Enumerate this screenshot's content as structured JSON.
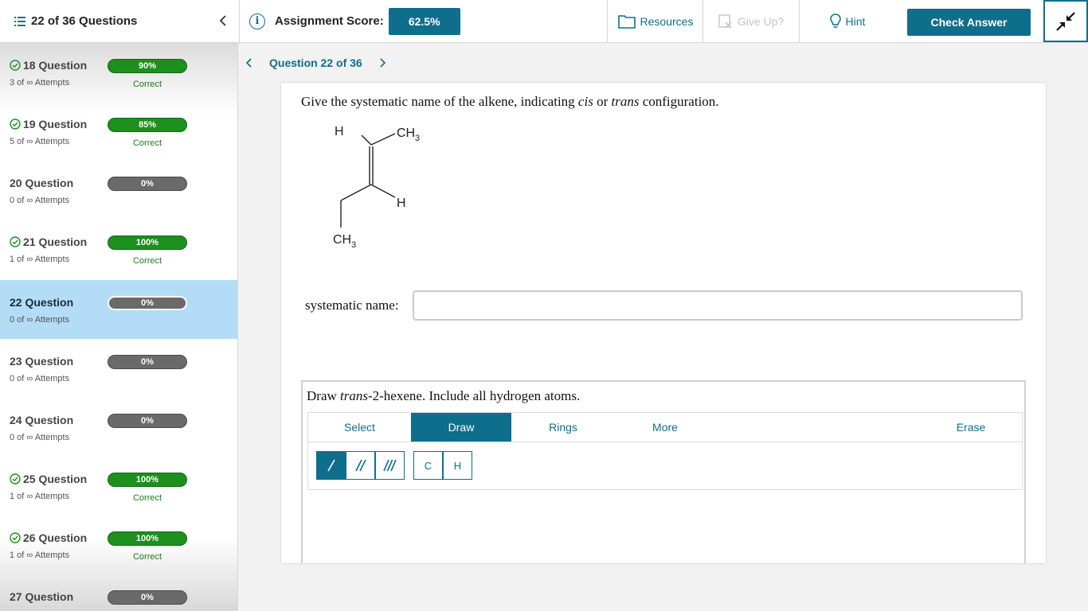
{
  "header": {
    "question_count": "22 of 36 Questions",
    "score_label": "Assignment Score:",
    "score_value": "62.5%",
    "resources": "Resources",
    "give_up": "Give Up?",
    "hint": "Hint",
    "check_answer": "Check Answer"
  },
  "sidebar": {
    "items": [
      {
        "title": "18 Question",
        "attempts": "3 of ∞ Attempts",
        "percent": "90%",
        "status": "Correct"
      },
      {
        "title": "19 Question",
        "attempts": "5 of ∞ Attempts",
        "percent": "85%",
        "status": "Correct"
      },
      {
        "title": "20 Question",
        "attempts": "0 of ∞ Attempts",
        "percent": "0%",
        "status": ""
      },
      {
        "title": "21 Question",
        "attempts": "1 of ∞ Attempts",
        "percent": "100%",
        "status": "Correct"
      },
      {
        "title": "22 Question",
        "attempts": "0 of ∞ Attempts",
        "percent": "0%",
        "status": ""
      },
      {
        "title": "23 Question",
        "attempts": "0 of ∞ Attempts",
        "percent": "0%",
        "status": ""
      },
      {
        "title": "24 Question",
        "attempts": "0 of ∞ Attempts",
        "percent": "0%",
        "status": ""
      },
      {
        "title": "25 Question",
        "attempts": "1 of ∞ Attempts",
        "percent": "100%",
        "status": "Correct"
      },
      {
        "title": "26 Question",
        "attempts": "1 of ∞ Attempts",
        "percent": "100%",
        "status": "Correct"
      },
      {
        "title": "27 Question",
        "attempts": "",
        "percent": "0%",
        "status": ""
      }
    ]
  },
  "main": {
    "nav_label": "Question 22 of 36",
    "prompt_pre": "Give the systematic name of the alkene, indicating ",
    "prompt_cis": "cis",
    "prompt_or": " or ",
    "prompt_trans": "trans",
    "prompt_post": " configuration.",
    "molecule": {
      "h_top": "H",
      "ch3_top": "CH",
      "sub3": "3",
      "h_right": "H",
      "ch3_bottom": "CH"
    },
    "name_label": "systematic name:",
    "name_value": "",
    "draw_pre": "Draw ",
    "draw_italic": "trans",
    "draw_post": "-2-hexene. Include all hydrogen atoms.",
    "tabs": {
      "select": "Select",
      "draw": "Draw",
      "rings": "Rings",
      "more": "More",
      "erase": "Erase"
    },
    "atoms": {
      "c": "C",
      "h": "H"
    }
  },
  "colors": {
    "accent": "#0f6e8c",
    "correct": "#1d8f1d",
    "neutral": "#6a6a6a",
    "active_row": "#b3dcf7"
  }
}
